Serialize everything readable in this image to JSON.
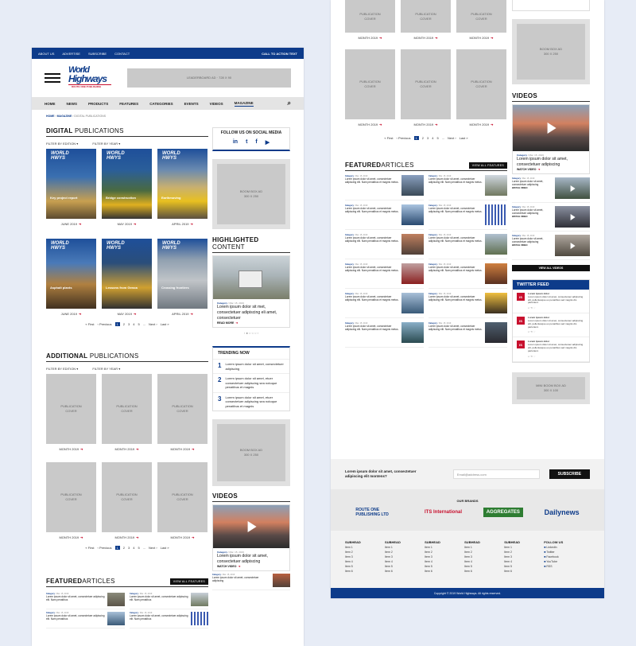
{
  "left": {
    "topbar": {
      "about": "ABOUT US",
      "advertise": "ADVERTISE",
      "subscribe": "SUBSCRIBE",
      "contact": "CONTACT",
      "cta": "CALL TO ACTION TEXT"
    },
    "logo": {
      "line1": "World",
      "line2": "Highways",
      "tagline": "ROUTE ONE PUBLISHING"
    },
    "leaderboard": "LEADERBOARD AD · 728 X 90",
    "nav": [
      "HOME",
      "NEWS",
      "PRODUCTS",
      "FEATURES",
      "CATEGORIES",
      "EVENTS",
      "VIDEOS",
      "MAGAZINE"
    ],
    "breadcrumb": {
      "home": "HOME",
      "magazine": "MAGAZINE",
      "current": "DIGITAL PUBLICATIONS"
    },
    "digital": {
      "title_bold": "DIGITAL",
      "title_rest": " PUBLICATIONS",
      "filter_edition": "FILTER BY EDITION ▾",
      "filter_year": "FILTER BY YEAR ▾",
      "covers": [
        {
          "month": "JUNE 2019",
          "text": "Key project report"
        },
        {
          "month": "MAY 2019",
          "text": "Bridge construction"
        },
        {
          "month": "APRIL 2019",
          "text": "Earthmoving"
        },
        {
          "month": "JUNE 2019",
          "text": "Asphalt plants"
        },
        {
          "month": "MAY 2019",
          "text": "Lessons from Genoa"
        },
        {
          "month": "APRIL 2019",
          "text": "Crossing frontiers"
        }
      ],
      "pagination": {
        "first": "« First",
        "prev": "‹ Previous",
        "pages": [
          "1",
          "2",
          "3",
          "4",
          "5",
          "..."
        ],
        "next": "Next ›",
        "last": "Last »"
      }
    },
    "follow": {
      "title": "FOLLOW US ON SOCIAL MEDIA",
      "icons": [
        "in",
        "t",
        "f",
        "▶"
      ]
    },
    "boom_ad": "BOOM BOX AD\n300 X 250",
    "highlighted": {
      "title_bold": "HIGHLIGHTED",
      "title_rest": " CONTENT",
      "category": "Category",
      "date": " / Mar. 15, 2019",
      "text": "Lorem ipsum dolor sit met, consectetuer adipiscing eli amet, consectetuer",
      "read_more": "READ MORE"
    },
    "additional": {
      "title_bold": "ADDITIONAL",
      "title_rest": " PUBLICATIONS",
      "filter_edition": "FILTER BY EDITION ▾",
      "filter_year": "FILTER BY YEAR ▾",
      "cover_label": "PUBLICATION\nCOVER",
      "month": "MONTH 2019",
      "pagination": {
        "first": "« First",
        "prev": "‹ Previous",
        "pages": [
          "1",
          "2",
          "3",
          "4",
          "5",
          "..."
        ],
        "next": "Next ›",
        "last": "Last »"
      }
    },
    "trending": {
      "title": "TRENDING NOW",
      "items": [
        {
          "n": "1",
          "text": "Lorem ipsum dolor sit amet, consectetuer adipiscing"
        },
        {
          "n": "2",
          "text": "Lorem ipsum dolor sit amet, etuer consectetuer adipiscing sea notoque penatibus et magnis"
        },
        {
          "n": "3",
          "text": "Lorem ipsum dolor sit amet, etuer consectetuer adipiscing sea notoque penatibus et magnis"
        }
      ]
    },
    "videos": {
      "title": "VIDEOS",
      "category": "Category",
      "date": " / Mar. 15, 2019",
      "text": "Lorem ipsum dolor sit amet, consectetuer adipiscing",
      "watch": "WATCH VIDEO"
    },
    "featured": {
      "title_bold": "FEATURED",
      "title_rest": " ARTICLES",
      "view_all": "VIEW ALL FEATURES",
      "category": "Category",
      "date": " / Mar. 15, 2019",
      "text": "Lorem ipsum dolor sit amet, consectetuer adipiscing elit. Nam penatibus"
    }
  },
  "right": {
    "month": "MONTH 2019",
    "cover_label": "PUBLICATION\nCOVER",
    "pagination": {
      "first": "« First",
      "prev": "‹ Previous",
      "pages": [
        "1",
        "2",
        "3",
        "4",
        "5",
        "..."
      ],
      "next": "Next ›",
      "last": "Last »"
    },
    "featured": {
      "title_bold": "FEATURED",
      "title_rest": " ARTICLES",
      "view_all": "VIEW ALL FEATURES",
      "category": "Category",
      "date": " / Mar. 15, 2019",
      "text": "Lorem ipsum dolor sit amet, consectetuer adipiscing elit. Nam penatibus et magnis metus."
    },
    "boom_ad": "BOOM BOX AD\n300 X 250",
    "videos": {
      "title": "VIDEOS",
      "category": "Category",
      "date": " / Mar. 15, 2019",
      "text": "Lorem ipsum dolor sit amet, consectetuer adipiscing",
      "watch": "WATCH VIDEO",
      "view_all": "VIEW ALL VIDEOS"
    },
    "twitter": {
      "title": "TWITTER FEED",
      "handle": "Lorem Ipsum dolor",
      "tweet": "Lorem ipsum dolor sit amet, consectetuer adipiscing elit, pellentesque eu penatibus sed magnis dis parturient.",
      "actions": "↩  ⟲  ♡"
    },
    "mini_ad": "MINI BOOM BOX AD\n300 X 100",
    "newsletter": {
      "text": "Lorem ipsum dolor sit amet, consectetuer adipiscing elit montens?",
      "placeholder": "Email@address.com",
      "button": "SUBSCRIBE"
    },
    "brands": {
      "title": "OUR BRANDS",
      "items": [
        "ROUTE ONE PUBLISHING LTD",
        "ITS International",
        "AGGREGATES",
        "Dailynews"
      ]
    },
    "footer": {
      "subhead": "SUBHEAD",
      "items": [
        "Item 1",
        "Item 2",
        "Item 3",
        "Item 4",
        "Item 5",
        "Item 6"
      ],
      "follow": "FOLLOW US",
      "social": [
        "LinkedIn",
        "Twitter",
        "Facebook",
        "YouTube",
        "RSS"
      ],
      "copyright": "Copyright © 2019 World Highways. All rights reserved."
    }
  },
  "colors": {
    "brand": "#0d3b8a",
    "accent": "#c8102e",
    "placeholder": "#c9c9c9"
  }
}
